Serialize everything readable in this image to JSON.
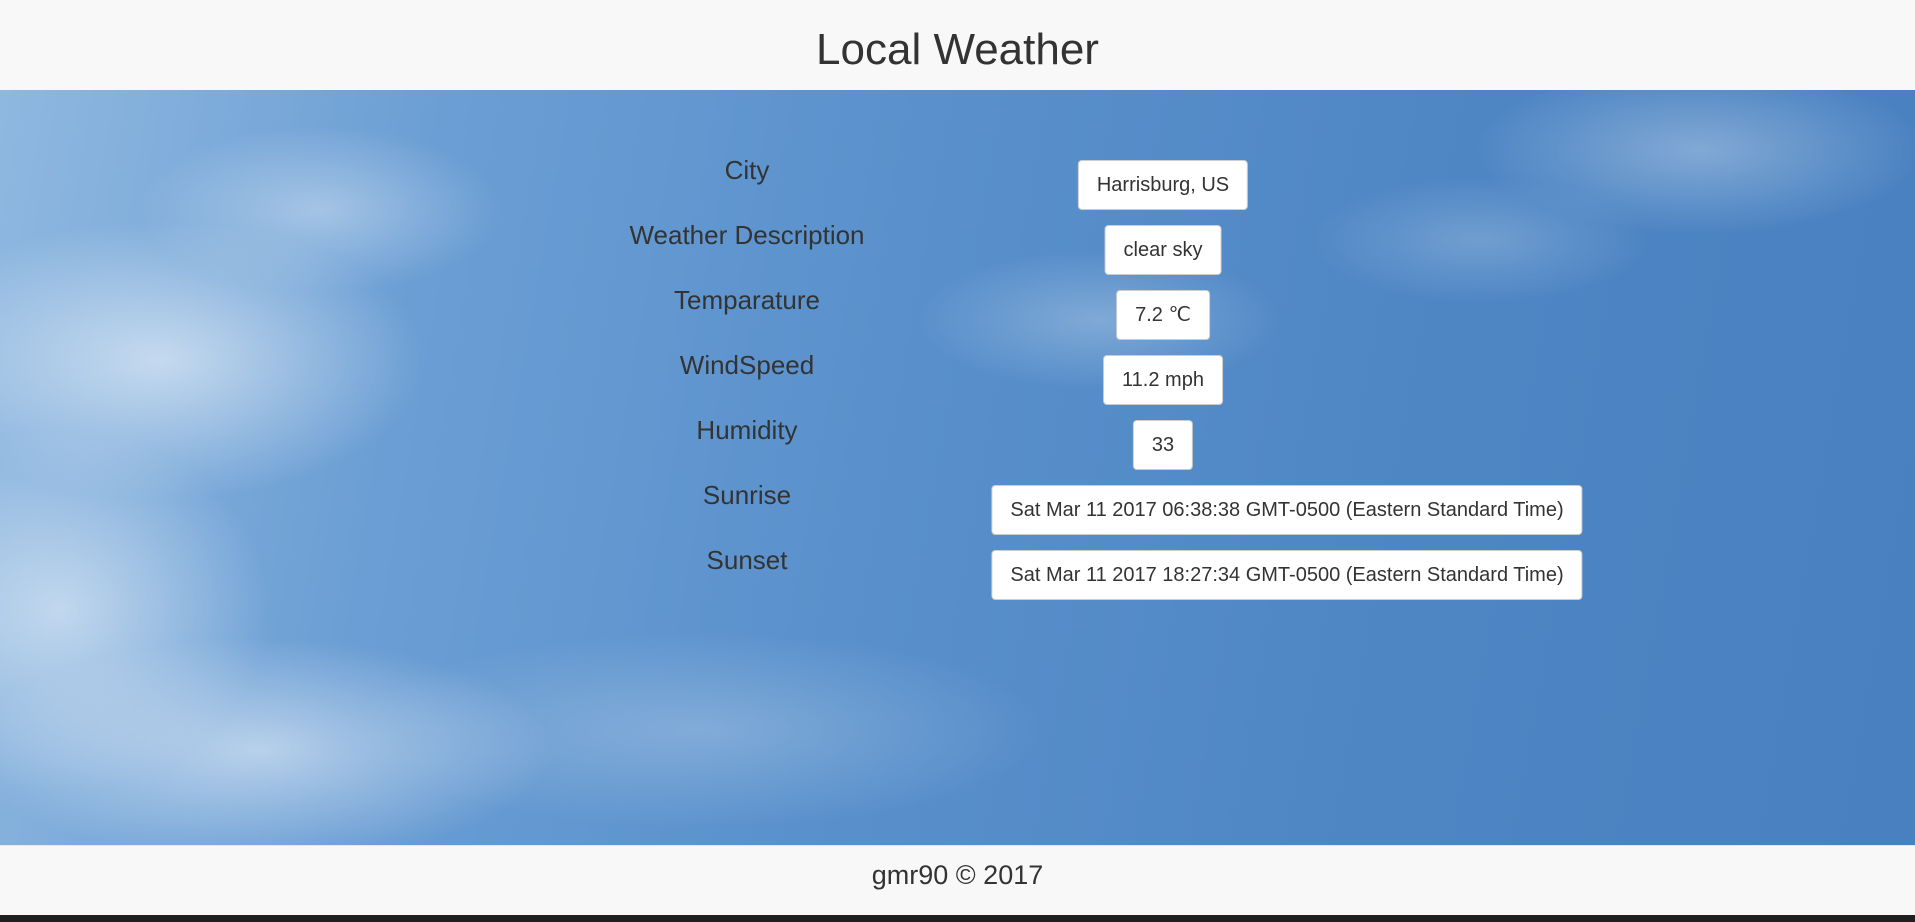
{
  "header": {
    "title": "Local Weather"
  },
  "weather": {
    "rows": [
      {
        "label": "City",
        "value": "Harrisburg, US"
      },
      {
        "label": "Weather Description",
        "value": "clear sky"
      },
      {
        "label": "Temparature",
        "value": "7.2 ℃"
      },
      {
        "label": "WindSpeed",
        "value": "11.2 mph"
      },
      {
        "label": "Humidity",
        "value": "33"
      },
      {
        "label": "Sunrise",
        "value": "Sat Mar 11 2017 06:38:38 GMT-0500 (Eastern Standard Time)"
      },
      {
        "label": "Sunset",
        "value": "Sat Mar 11 2017 18:27:34 GMT-0500 (Eastern Standard Time)"
      }
    ]
  },
  "footer": {
    "text": "gmr90 © 2017"
  },
  "colors": {
    "header_bg": "#f8f8f8",
    "sky_blue": "#4f87c5",
    "text": "#333333",
    "value_box_bg": "#ffffff"
  }
}
